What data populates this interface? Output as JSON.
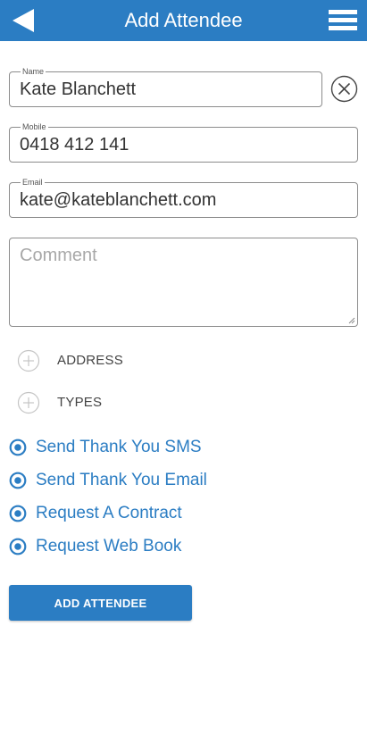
{
  "header": {
    "title": "Add Attendee",
    "back_icon": "back-arrow-icon",
    "menu_icon": "hamburger-menu-icon",
    "color": "#2b7dc3"
  },
  "form": {
    "name": {
      "label": "Name",
      "value": "Kate Blanchett",
      "clear_icon": "clear-circle-icon"
    },
    "mobile": {
      "label": "Mobile",
      "value": "0418 412 141"
    },
    "email": {
      "label": "Email",
      "value": "kate@kateblanchett.com"
    },
    "comment": {
      "placeholder": "Comment",
      "value": ""
    }
  },
  "sections": [
    {
      "label": "ADDRESS",
      "icon": "plus-circle-icon"
    },
    {
      "label": "TYPES",
      "icon": "plus-circle-icon"
    }
  ],
  "options": [
    {
      "label": "Send Thank You SMS",
      "selected": true
    },
    {
      "label": "Send Thank You Email",
      "selected": true
    },
    {
      "label": "Request A Contract",
      "selected": true
    },
    {
      "label": "Request Web Book",
      "selected": true
    }
  ],
  "actions": {
    "submit_label": "ADD ATTENDEE"
  }
}
